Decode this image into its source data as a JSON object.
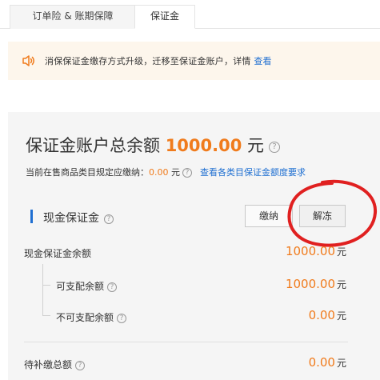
{
  "tabs": [
    {
      "label": "订单险 & 账期保障"
    },
    {
      "label": "保证金"
    }
  ],
  "notice": {
    "text": "消保保证金缴存方式升级，迁移至保证金账户，详情",
    "link": "查看",
    "icon": "speaker-icon"
  },
  "summary": {
    "title_prefix": "保证金账户总余额",
    "amount": "1000.00",
    "unit": "元",
    "sub_prefix": "当前在售商品类目规定应缴纳：",
    "sub_amount": "0.00",
    "sub_unit": "元",
    "sub_link": "查看各类目保证金额度要求"
  },
  "cash_section": {
    "label": "现金保证金",
    "pay_button": "缴纳",
    "unfreeze_button": "解冻"
  },
  "rows": [
    {
      "label": "现金保证金余额",
      "value": "1000.00",
      "unit": "元"
    },
    {
      "label": "可支配余额",
      "value": "1000.00",
      "unit": "元"
    },
    {
      "label": "不可支配余额",
      "value": "0.00",
      "unit": "元"
    },
    {
      "label": "待补缴总额",
      "value": "0.00",
      "unit": "元"
    }
  ],
  "colors": {
    "accent_orange": "#f07b1c",
    "link_blue": "#1f6fd1",
    "annotation_red": "#e02020",
    "notice_bg": "#fdf6ec"
  }
}
